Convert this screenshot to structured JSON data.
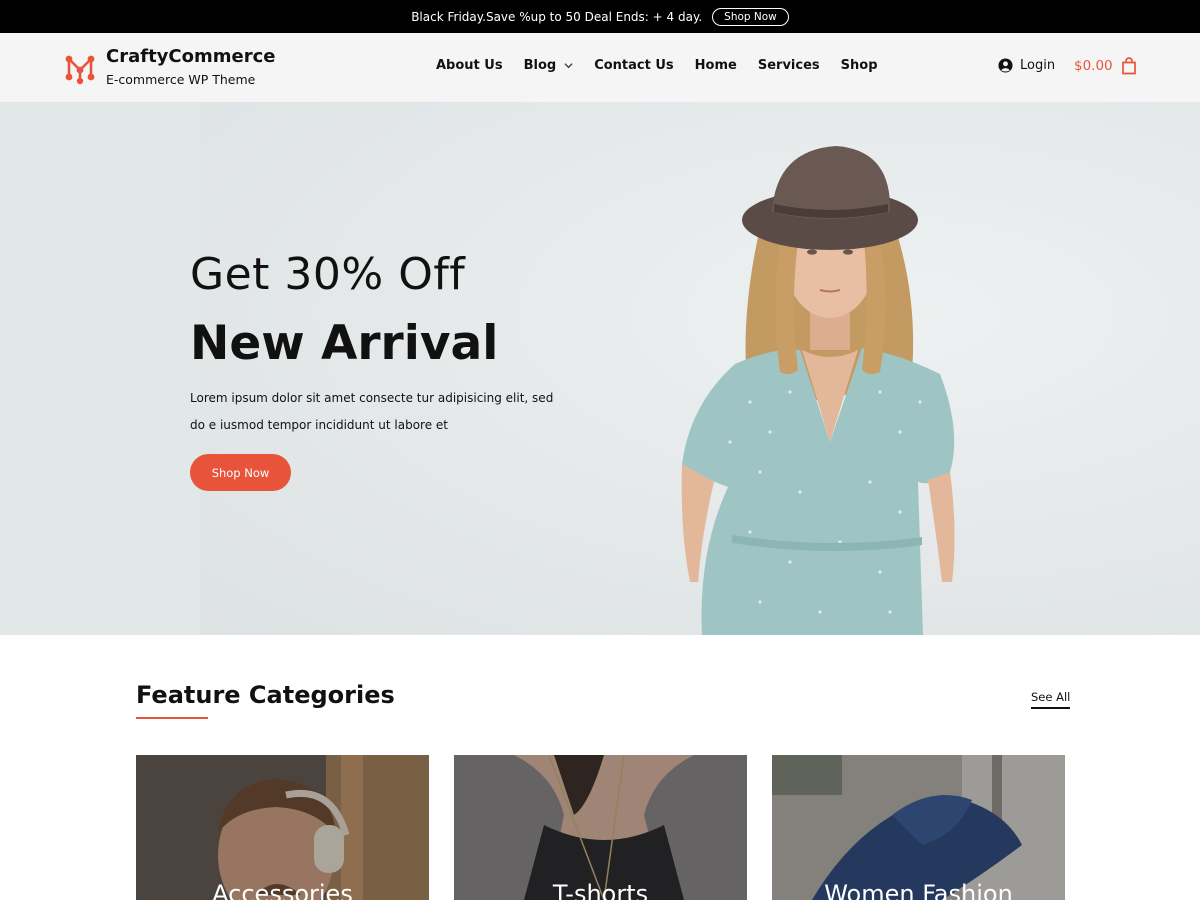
{
  "announcement": {
    "text": "Black Friday.Save %up to 50 Deal Ends: + 4 day.",
    "button_label": "Shop Now"
  },
  "header": {
    "brand_name": "CraftyCommerce",
    "brand_tagline": "E-commerce WP Theme",
    "nav": [
      {
        "label": "About Us"
      },
      {
        "label": "Blog",
        "has_dropdown": true
      },
      {
        "label": "Contact Us"
      },
      {
        "label": "Home"
      },
      {
        "label": "Services"
      },
      {
        "label": "Shop"
      }
    ],
    "login_label": "Login",
    "cart_total": "$0.00"
  },
  "hero": {
    "headline": "Get 30% Off",
    "title": "New Arrival",
    "description": "Lorem ipsum dolor sit amet consecte tur adipisicing elit, sed do e iusmod tempor incididunt ut labore et",
    "button_label": "Shop Now"
  },
  "categories": {
    "title": "Feature Categories",
    "see_all_label": "See All",
    "items": [
      {
        "label": "Accessories"
      },
      {
        "label": "T-shorts"
      },
      {
        "label": "Women Fashion"
      }
    ]
  },
  "colors": {
    "accent": "#e8543a",
    "topbar_bg": "#000000",
    "header_bg": "#f5f5f5",
    "hero_bg": "#e2e7e8"
  }
}
